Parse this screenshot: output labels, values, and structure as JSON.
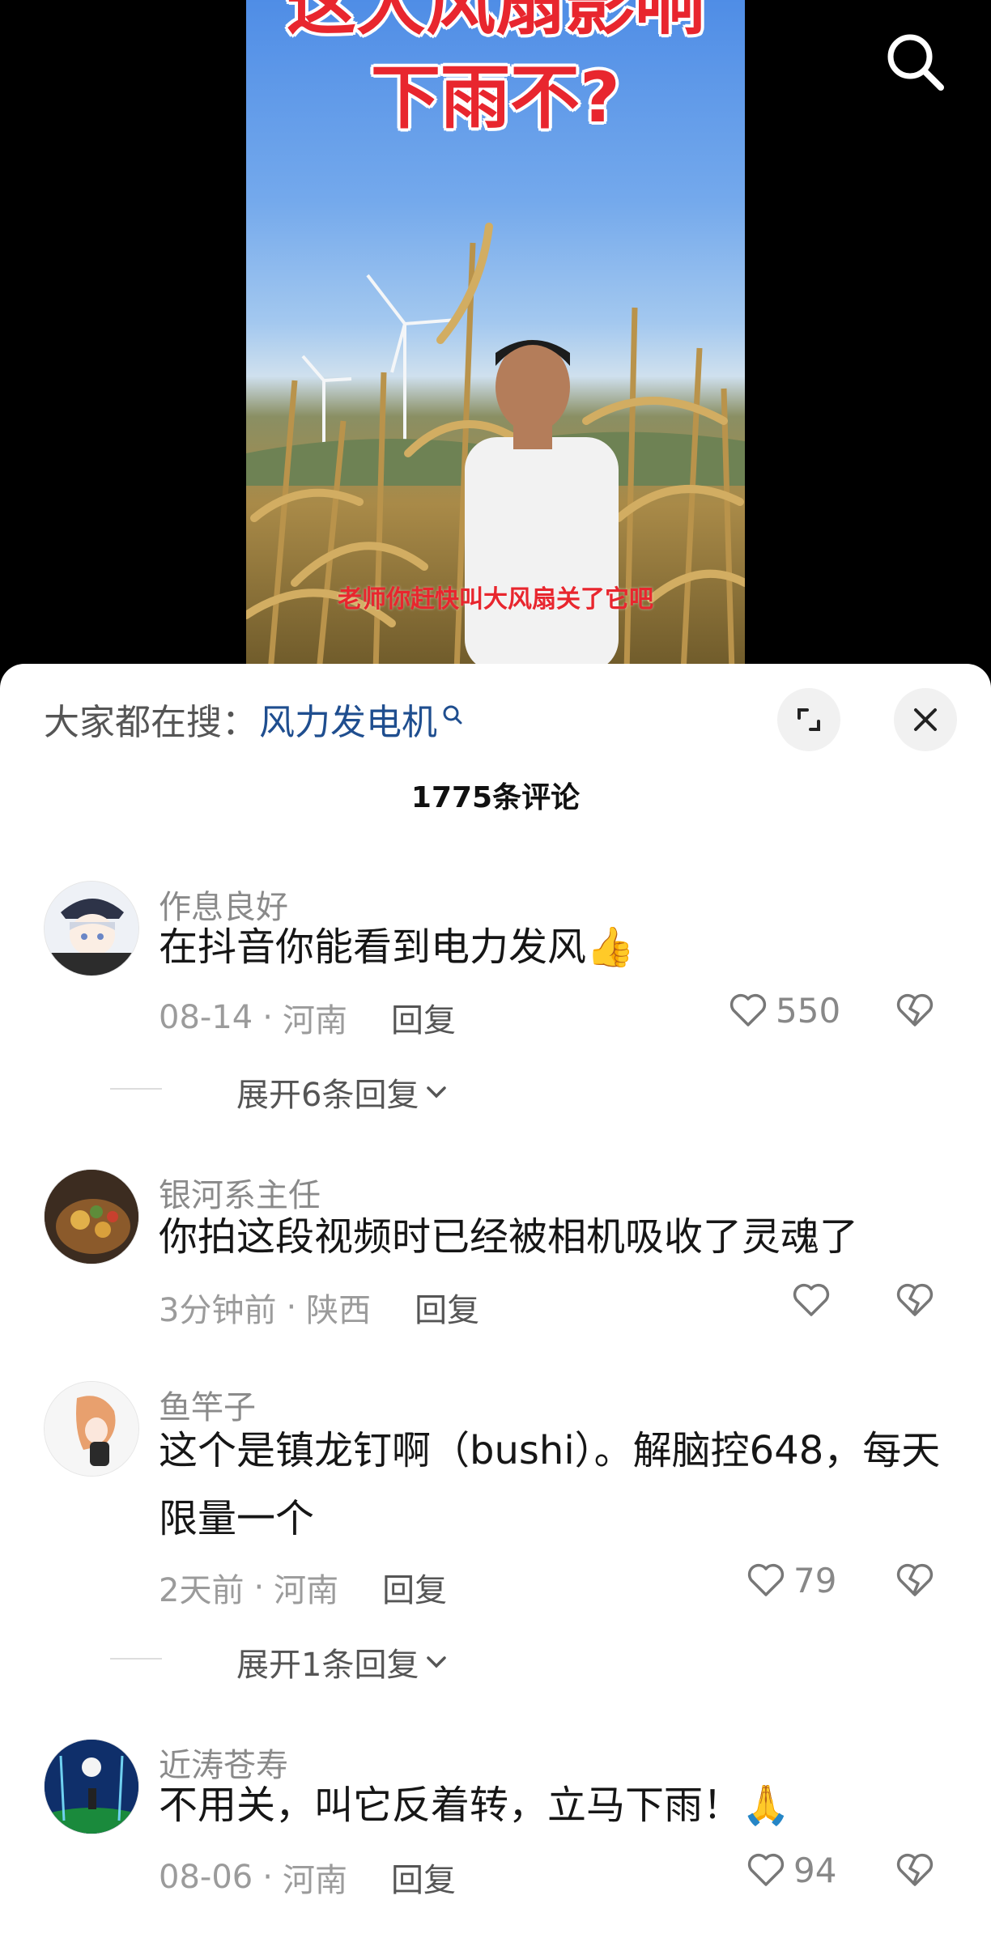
{
  "video": {
    "title_line1": "这大风扇影响",
    "title_line2": "下雨不?",
    "subtitle": "老师你赶快叫大风扇关了它吧",
    "search_icon": "search-icon"
  },
  "sheet": {
    "search_label": "大家都在搜：",
    "search_keyword": "风力发电机",
    "comment_count": "1775条评论"
  },
  "comments": [
    {
      "username": "作息良好",
      "text": "在抖音你能看到电力发风👍",
      "date": "08-14",
      "location": "河南",
      "reply": "回复",
      "likes": "550",
      "expand": "展开6条回复"
    },
    {
      "username": "银河系主任",
      "text": "你拍这段视频时已经被相机吸收了灵魂了",
      "date": "3分钟前",
      "location": "陕西",
      "reply": "回复",
      "likes": ""
    },
    {
      "username": "鱼竿子",
      "text": "这个是镇龙钉啊（bushi）。解脑控648，每天限量一个",
      "date": "2天前",
      "location": "河南",
      "reply": "回复",
      "likes": "79",
      "expand": "展开1条回复"
    },
    {
      "username": "近涛苍寿",
      "text": "不用关，叫它反着转，立马下雨！🙏",
      "date": "08-06",
      "location": "河南",
      "reply": "回复",
      "likes": "94"
    }
  ],
  "separator": "·",
  "colors": {
    "accent_link": "#1f4e8f",
    "video_title_red": "#e8262e",
    "muted_text": "#8a8a8a"
  }
}
